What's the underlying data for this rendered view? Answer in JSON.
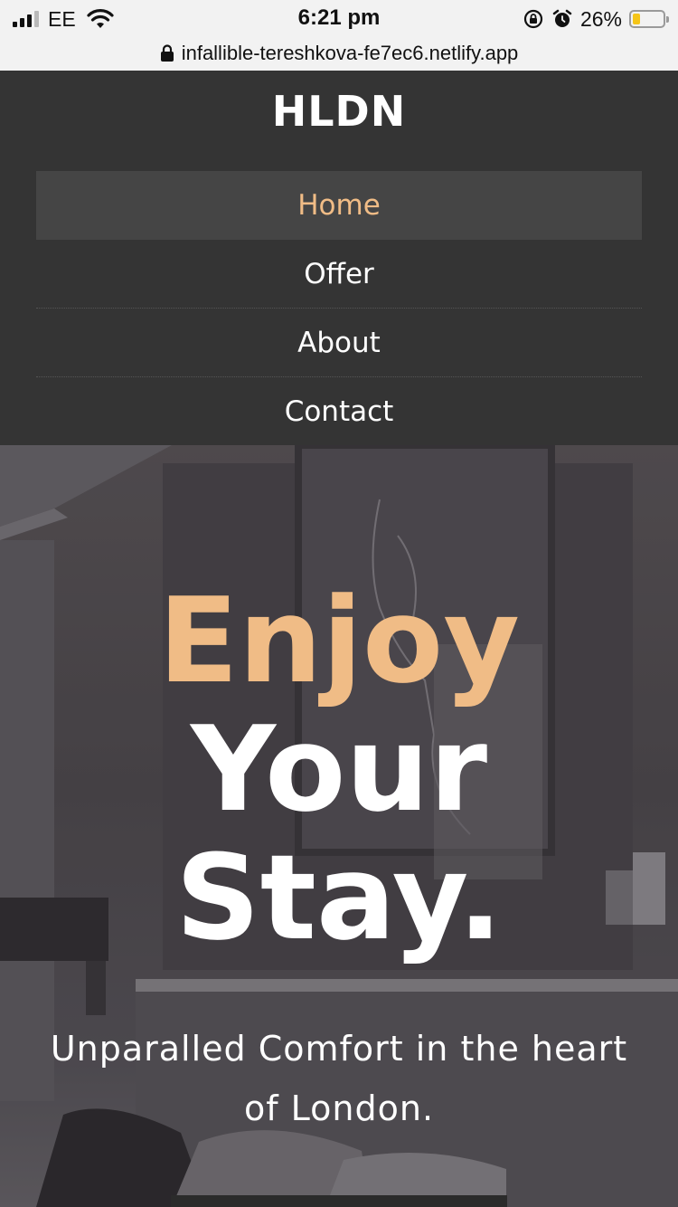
{
  "status_bar": {
    "carrier": "EE",
    "time": "6:21 pm",
    "battery_percent": "26%",
    "battery_level": 0.26,
    "battery_color": "#f5c518",
    "icons": [
      "signal-icon",
      "wifi-icon",
      "orientation-lock-icon",
      "alarm-icon",
      "battery-icon"
    ]
  },
  "url_bar": {
    "url": "infallible-tereshkova-fe7ec6.netlify.app",
    "icon": "lock-icon"
  },
  "header": {
    "logo": "HLDN",
    "background": "#343434",
    "nav": [
      {
        "label": "Home",
        "active": true
      },
      {
        "label": "Offer",
        "active": false
      },
      {
        "label": "About",
        "active": false
      },
      {
        "label": "Contact",
        "active": false
      }
    ]
  },
  "hero": {
    "title_line1": "Enjoy",
    "title_line2": "Your",
    "title_line3": "Stay.",
    "subtitle": "Unparalled Comfort in the heart of London.",
    "accent_color": "#f0bc86"
  }
}
